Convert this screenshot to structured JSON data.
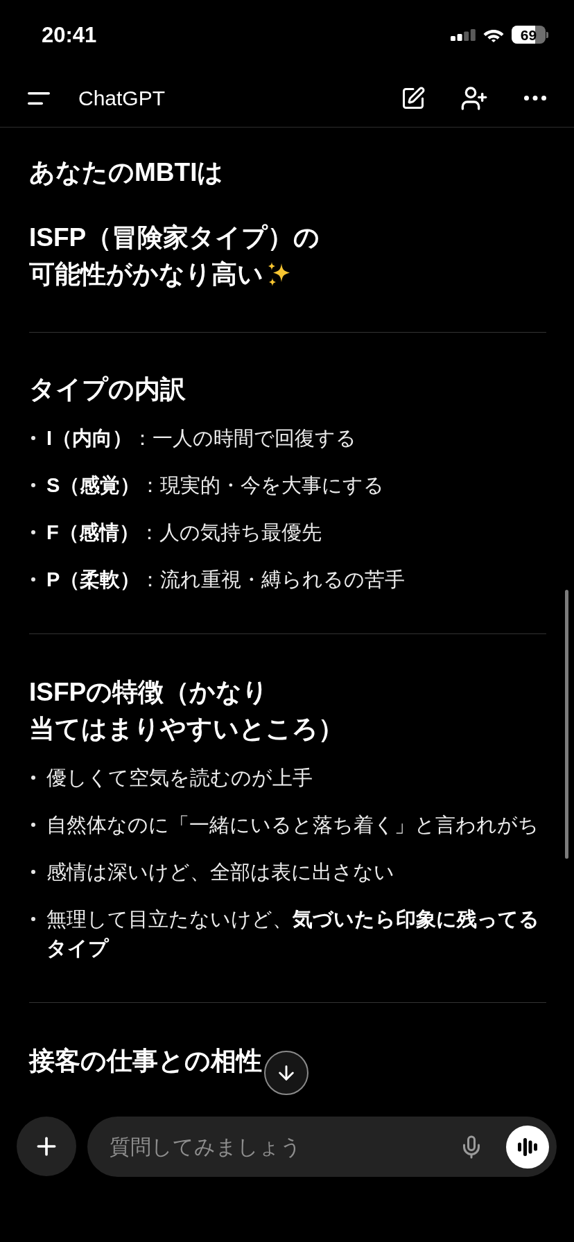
{
  "status_bar": {
    "time": "20:41",
    "battery": "69"
  },
  "header": {
    "title": "ChatGPT"
  },
  "message": {
    "intro": "あなたのMBTIは",
    "result_lines": [
      "ISFP（冒険家タイプ）の",
      "可能性がかなり高い"
    ],
    "sections": [
      {
        "heading_lines": [
          "タイプの内訳"
        ],
        "items": [
          "**I（内向）**：一人の時間で回復する",
          "**S（感覚）**：現実的・今を大事にする",
          "**F（感情）**：人の気持ち最優先",
          "**P（柔軟）**：流れ重視・縛られるの苦手"
        ]
      },
      {
        "heading_lines": [
          "ISFPの特徴（かなり",
          "当てはまりやすいところ）"
        ],
        "items": [
          "優しくて空気を読むのが上手",
          "自然体なのに「一緒にいると落ち着く」と言われがち",
          "感情は深いけど、全部は表に出さない",
          "無理して目立たないけど、**気づいたら印象に残ってるタイプ**"
        ]
      },
      {
        "heading_lines": [
          "接客の仕事との相性"
        ]
      }
    ]
  },
  "composer": {
    "placeholder": "質問してみましょう"
  }
}
